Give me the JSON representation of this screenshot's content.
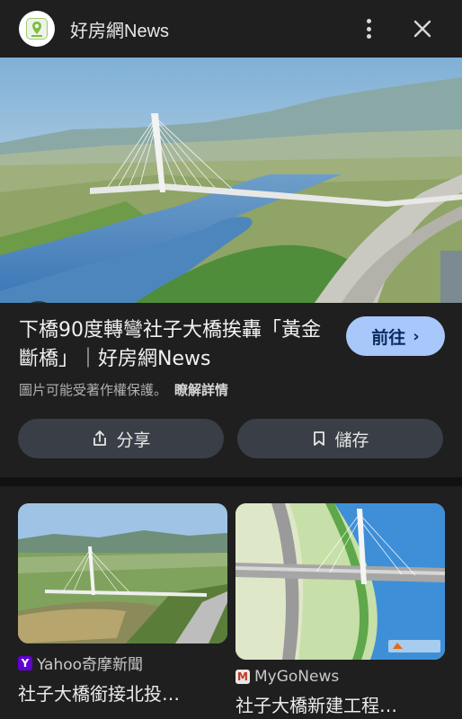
{
  "header": {
    "app_title": "好房網News",
    "app_icon": "app-logo-icon",
    "menu_icon": "more-vert-icon",
    "close_icon": "close-icon"
  },
  "hero": {
    "lens_icon": "lens-search-icon"
  },
  "result": {
    "title": "下橋90度轉彎社子大橋挨轟「黃金斷橋」｜好房網News",
    "copyright_notice": "圖片可能受著作權保護。",
    "learn_more": "瞭解詳情",
    "visit_label": "前往",
    "visit_chevron": "›",
    "share_label": "分享",
    "save_label": "儲存"
  },
  "colors": {
    "background": "#1f1f1f",
    "visit_button": "#a8c7fa",
    "action_button": "#3a3f47"
  },
  "related": [
    {
      "source": "Yahoo奇摩新聞",
      "source_icon": "yahoo-icon",
      "title": "社子大橋銜接北投…"
    },
    {
      "source": "MyGoNews",
      "source_icon": "mygonews-icon",
      "title": "社子大橋新建工程…"
    }
  ]
}
